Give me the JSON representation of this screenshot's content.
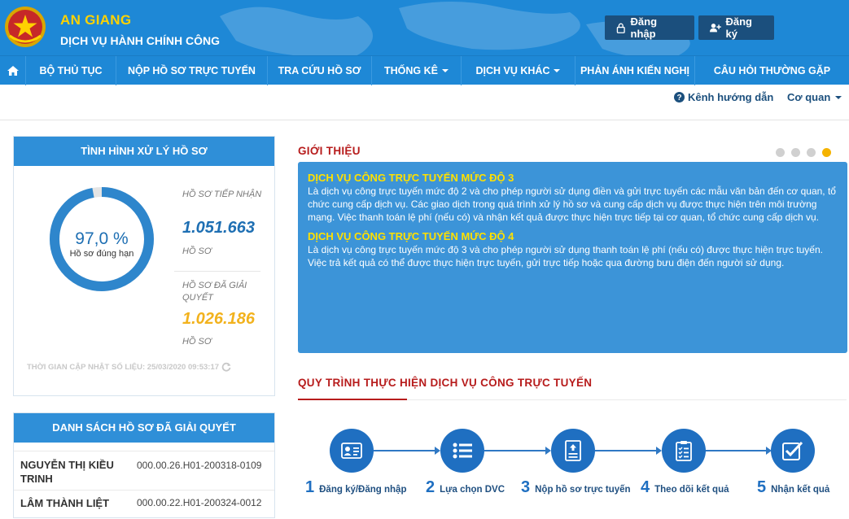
{
  "header": {
    "title": "AN GIANG",
    "subtitle": "DỊCH VỤ HÀNH CHÍNH CÔNG",
    "login_label": "Đăng nhập",
    "register_label": "Đăng ký",
    "emblem_icon": "national-emblem-icon"
  },
  "nav": {
    "home_icon": "home-icon",
    "items": [
      {
        "label": "BỘ THỦ TỤC",
        "dropdown": false
      },
      {
        "label": "NỘP HỒ SƠ TRỰC TUYẾN",
        "dropdown": false
      },
      {
        "label": "TRA CỨU HỒ SƠ",
        "dropdown": false
      },
      {
        "label": "THỐNG KÊ",
        "dropdown": true
      },
      {
        "label": "DỊCH VỤ KHÁC",
        "dropdown": true
      },
      {
        "label": "PHẢN ÁNH KIẾN NGHỊ",
        "dropdown": false
      },
      {
        "label": "CÂU HỎI THƯỜNG GẶP",
        "dropdown": false
      }
    ]
  },
  "subbar": {
    "guide_label": "Kênh hướng dẫn",
    "agency_label": "Cơ quan"
  },
  "stats": {
    "title": "TÌNH HÌNH XỬ LÝ HỒ SƠ",
    "on_time_percent": 97.0,
    "on_time_value": "97,0 %",
    "on_time_label": "Hồ sơ đúng hạn",
    "received_label": "HỒ SƠ TIẾP NHẬN",
    "received_value": "1.051.663",
    "received_unit": "HỒ SƠ",
    "resolved_label": "HỒ SƠ ĐÃ GIẢI QUYẾT",
    "resolved_value": "1.026.186",
    "resolved_unit": "HỒ SƠ",
    "update_text": "THỜI GIAN CẬP NHẬT SỐ LIỆU: 25/03/2020 09:53:17"
  },
  "resolved_list": {
    "title": "DANH SÁCH HỒ SƠ ĐÃ GIẢI QUYẾT",
    "rows": [
      {
        "name": "NGUYỄN THỊ KIỀU TRINH",
        "code": "000.00.26.H01-200318-0109"
      },
      {
        "name": "LÂM THÀNH LIỆT",
        "code": "000.00.22.H01-200324-0012"
      }
    ]
  },
  "intro": {
    "title": "GIỚI THIỆU",
    "carousel_active": 4,
    "carousel_total": 4,
    "blocks": [
      {
        "heading": "DỊCH VỤ CÔNG TRỰC TUYẾN MỨC ĐỘ 3",
        "text": "Là dịch vụ công trực tuyến mức độ 2 và cho phép người sử dụng điền và gửi trực tuyến các mẫu văn bản đến cơ quan, tổ chức cung cấp dịch vụ. Các giao dịch trong quá trình xử lý hồ sơ và cung cấp dịch vụ được thực hiện trên môi trường mạng. Việc thanh toán lệ phí (nếu có) và nhận kết quả được thực hiện trực tiếp tại cơ quan, tổ chức cung cấp dịch vụ."
      },
      {
        "heading": "DỊCH VỤ CÔNG TRỰC TUYẾN MỨC ĐỘ 4",
        "text": "Là dịch vụ công trực tuyến mức độ 3 và cho phép người sử dụng thanh toán lệ phí (nếu có) được thực hiện trực tuyến. Việc trả kết quả có thể được thực hiện trực tuyến, gửi trực tiếp hoặc qua đường bưu điện đến người sử dụng."
      }
    ]
  },
  "process": {
    "title": "QUY TRÌNH THỰC HIỆN DỊCH VỤ CÔNG TRỰC TUYẾN",
    "steps": [
      {
        "num": "1",
        "label": "Đăng ký/Đăng nhập",
        "icon": "id-card-icon"
      },
      {
        "num": "2",
        "label": "Lựa chọn DVC",
        "icon": "list-icon"
      },
      {
        "num": "3",
        "label": "Nộp hồ sơ trực tuyến",
        "icon": "document-upload-icon"
      },
      {
        "num": "4",
        "label": "Theo dõi kết quả",
        "icon": "checklist-icon"
      },
      {
        "num": "5",
        "label": "Nhận kết quả",
        "icon": "checkbox-icon"
      }
    ]
  },
  "colors": {
    "primary": "#1e88d6",
    "dark_button": "#1b4f7d",
    "accent_yellow": "#ffd200",
    "section_red": "#b71c1c",
    "received_blue": "#1e6fb3",
    "resolved_gold": "#f2b21d"
  }
}
